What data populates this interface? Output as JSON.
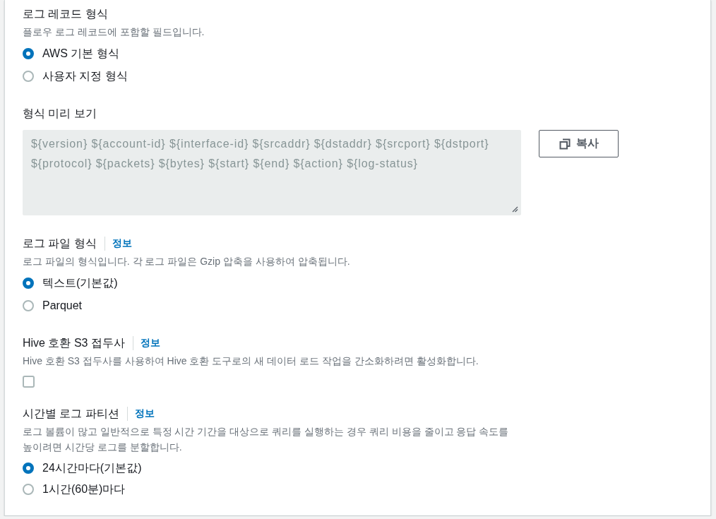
{
  "sections": [
    {
      "kind": "radio",
      "title": "로그 레코드 형식",
      "description": "플로우 로그 레코드에 포함할 필드입니다.",
      "options": [
        {
          "label": "AWS 기본 형식",
          "selected": true
        },
        {
          "label": "사용자 지정 형식",
          "selected": false
        }
      ]
    },
    {
      "kind": "preview",
      "title": "형식 미리 보기",
      "value": "${version} ${account-id} ${interface-id} ${srcaddr} ${dstaddr} ${srcport} ${dstport} ${protocol} ${packets} ${bytes} ${start} ${end} ${action} ${log-status}",
      "copy_button": "복사"
    },
    {
      "kind": "radio",
      "title": "로그 파일 형식",
      "info_link": "정보",
      "description": "로그 파일의 형식입니다. 각 로그 파일은 Gzip 압축을 사용하여 압축됩니다.",
      "options": [
        {
          "label": "텍스트(기본값)",
          "selected": true
        },
        {
          "label": "Parquet",
          "selected": false
        }
      ]
    },
    {
      "kind": "checkbox",
      "title": "Hive 호환 S3 접두사",
      "info_link": "정보",
      "description": "Hive 호환 S3 접두사를 사용하여 Hive 호환 도구로의 새 데이터 로드 작업을 간소화하려면 활성화합니다.",
      "checked": false
    },
    {
      "kind": "radio",
      "title": "시간별 로그 파티션",
      "info_link": "정보",
      "description": "로그 볼륨이 많고 일반적으로 특정 시간 기간을 대상으로 쿼리를 실행하는 경우 쿼리 비용을 줄이고 응답 속도를 높이려면 시간당 로그를 분할합니다.",
      "options": [
        {
          "label": "24시간마다(기본값)",
          "selected": true
        },
        {
          "label": "1시간(60분)마다",
          "selected": false
        }
      ]
    }
  ]
}
